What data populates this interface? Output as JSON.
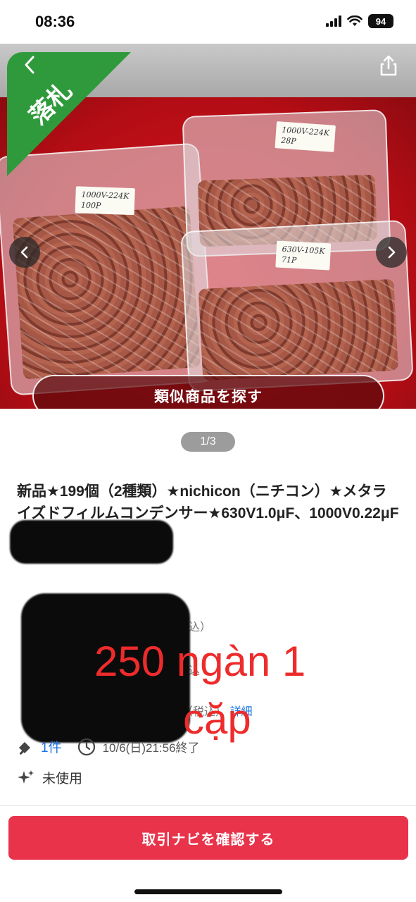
{
  "status_bar": {
    "time": "08:36",
    "battery": "94"
  },
  "hero": {
    "sold_badge": "落札",
    "similar_button": "類似商品を探す",
    "bag_labels": [
      "1000V-224K\n100P",
      "1000V-224K\n28P",
      "630V-105K\n71P"
    ],
    "page_indicator": "1/3"
  },
  "listing": {
    "title": "新品★199個（2種類）★nichicon（ニチコン）★メタライズドフィルムコンデンサー★630V1.0μF、1000V0.22μF（B級品）",
    "price_fragment": "込）",
    "buy_now_fragment": "込",
    "shipping_fragment": "（税込）",
    "detail_link": "詳細",
    "bids": "1件",
    "end_time": "10/6(日)21:56終了",
    "condition": "未使用"
  },
  "overlay": {
    "line1": "250 ngàn 1",
    "line2": "cặp"
  },
  "footer": {
    "cta_label": "取引ナビを確認する"
  },
  "colors": {
    "accent": "#e8334b",
    "sold_green": "#2f9a3c",
    "link": "#1a73e8",
    "overlay_red": "#ee2b2b"
  }
}
